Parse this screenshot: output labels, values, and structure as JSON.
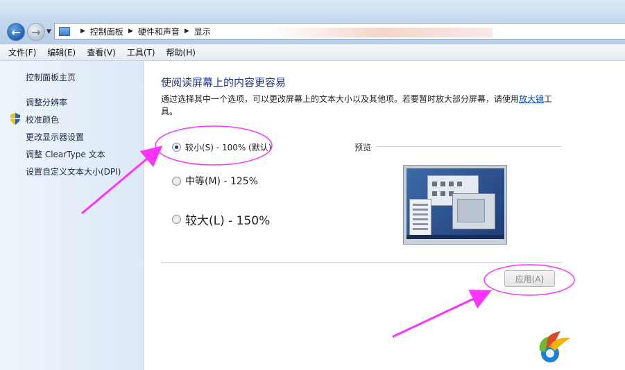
{
  "nav": {
    "back_icon": "back-arrow-icon",
    "forward_icon": "forward-arrow-icon",
    "history_icon": "chevron-down-icon"
  },
  "breadcrumb": {
    "items": [
      "控制面板",
      "硬件和声音",
      "显示"
    ]
  },
  "menu": {
    "items": [
      "文件(F)",
      "编辑(E)",
      "查看(V)",
      "工具(T)",
      "帮助(H)"
    ]
  },
  "sidebar": {
    "home": "控制面板主页",
    "links": [
      "调整分辨率",
      "校准颜色",
      "更改显示器设置",
      "调整 ClearType 文本",
      "设置自定义文本大小(DPI)"
    ]
  },
  "main": {
    "title": "使阅读屏幕上的内容更容易",
    "description_before": "通过选择其中一个选项，可以更改屏幕上的文本大小以及其他项。若要暂时放大部分屏幕，请使用",
    "description_link": "放大镜",
    "description_after": "工具。",
    "options": [
      {
        "label": "较小(S) - 100% (默认)",
        "checked": true
      },
      {
        "label": "中等(M) - 125%",
        "checked": false
      },
      {
        "label": "较大(L) - 150%",
        "checked": false
      }
    ],
    "preview_label": "预览",
    "apply_button": "应用(A)"
  },
  "colors": {
    "annotation": "#ff33ff",
    "title": "#1e3287",
    "link": "#0645ad"
  }
}
